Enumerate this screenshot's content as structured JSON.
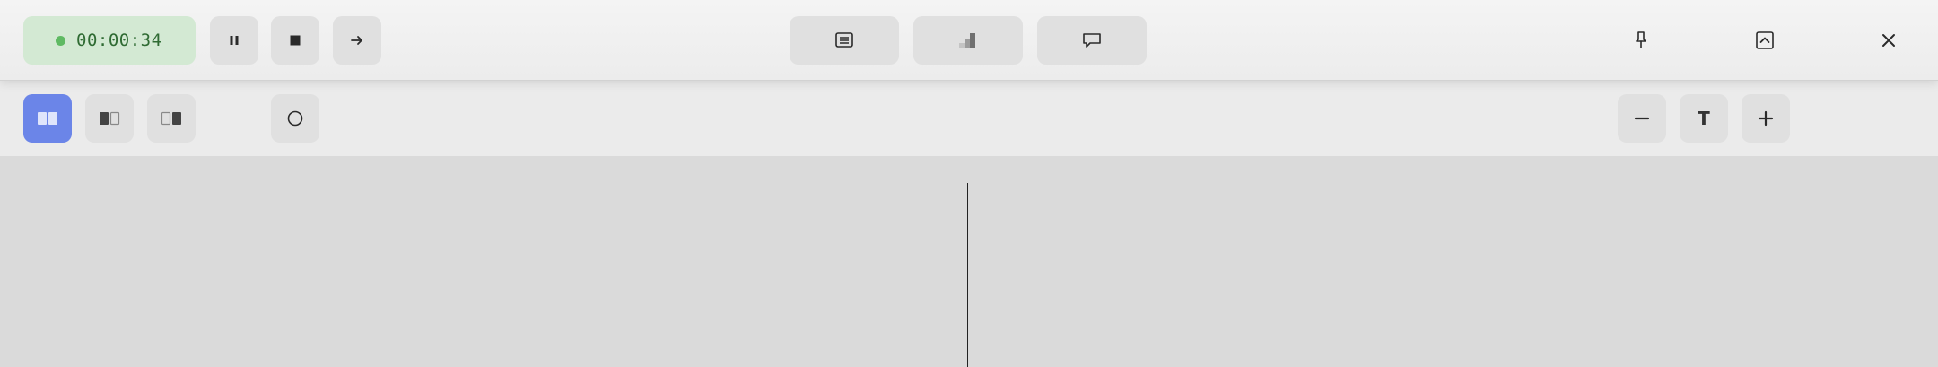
{
  "toolbar": {
    "timer": {
      "value": "00:00:34",
      "status": "recording"
    },
    "controls": [
      {
        "icon": "pause-icon"
      },
      {
        "icon": "stop-icon"
      },
      {
        "icon": "arrow-right-icon"
      }
    ],
    "center": [
      {
        "icon": "notes-icon"
      },
      {
        "icon": "bar-chart-icon"
      },
      {
        "icon": "chat-bubble-icon"
      }
    ],
    "window_controls": [
      {
        "icon": "pin-icon"
      },
      {
        "icon": "collapse-icon"
      },
      {
        "icon": "close-icon"
      }
    ]
  },
  "view_bar": {
    "layout_modes": [
      {
        "icon": "split-view-icon",
        "active": true
      },
      {
        "icon": "left-focus-icon",
        "active": false
      },
      {
        "icon": "right-focus-icon",
        "active": false
      }
    ],
    "circle_tool": {
      "icon": "circle-icon"
    },
    "text_size": {
      "decrease_icon": "minus-icon",
      "label": "T",
      "increase_icon": "plus-icon"
    }
  },
  "colors": {
    "accent": "#6b85e8",
    "timer_bg": "#d3e9d3",
    "timer_dot": "#5fba63",
    "timer_text": "#2f6b33",
    "canvas": "#dadada"
  }
}
